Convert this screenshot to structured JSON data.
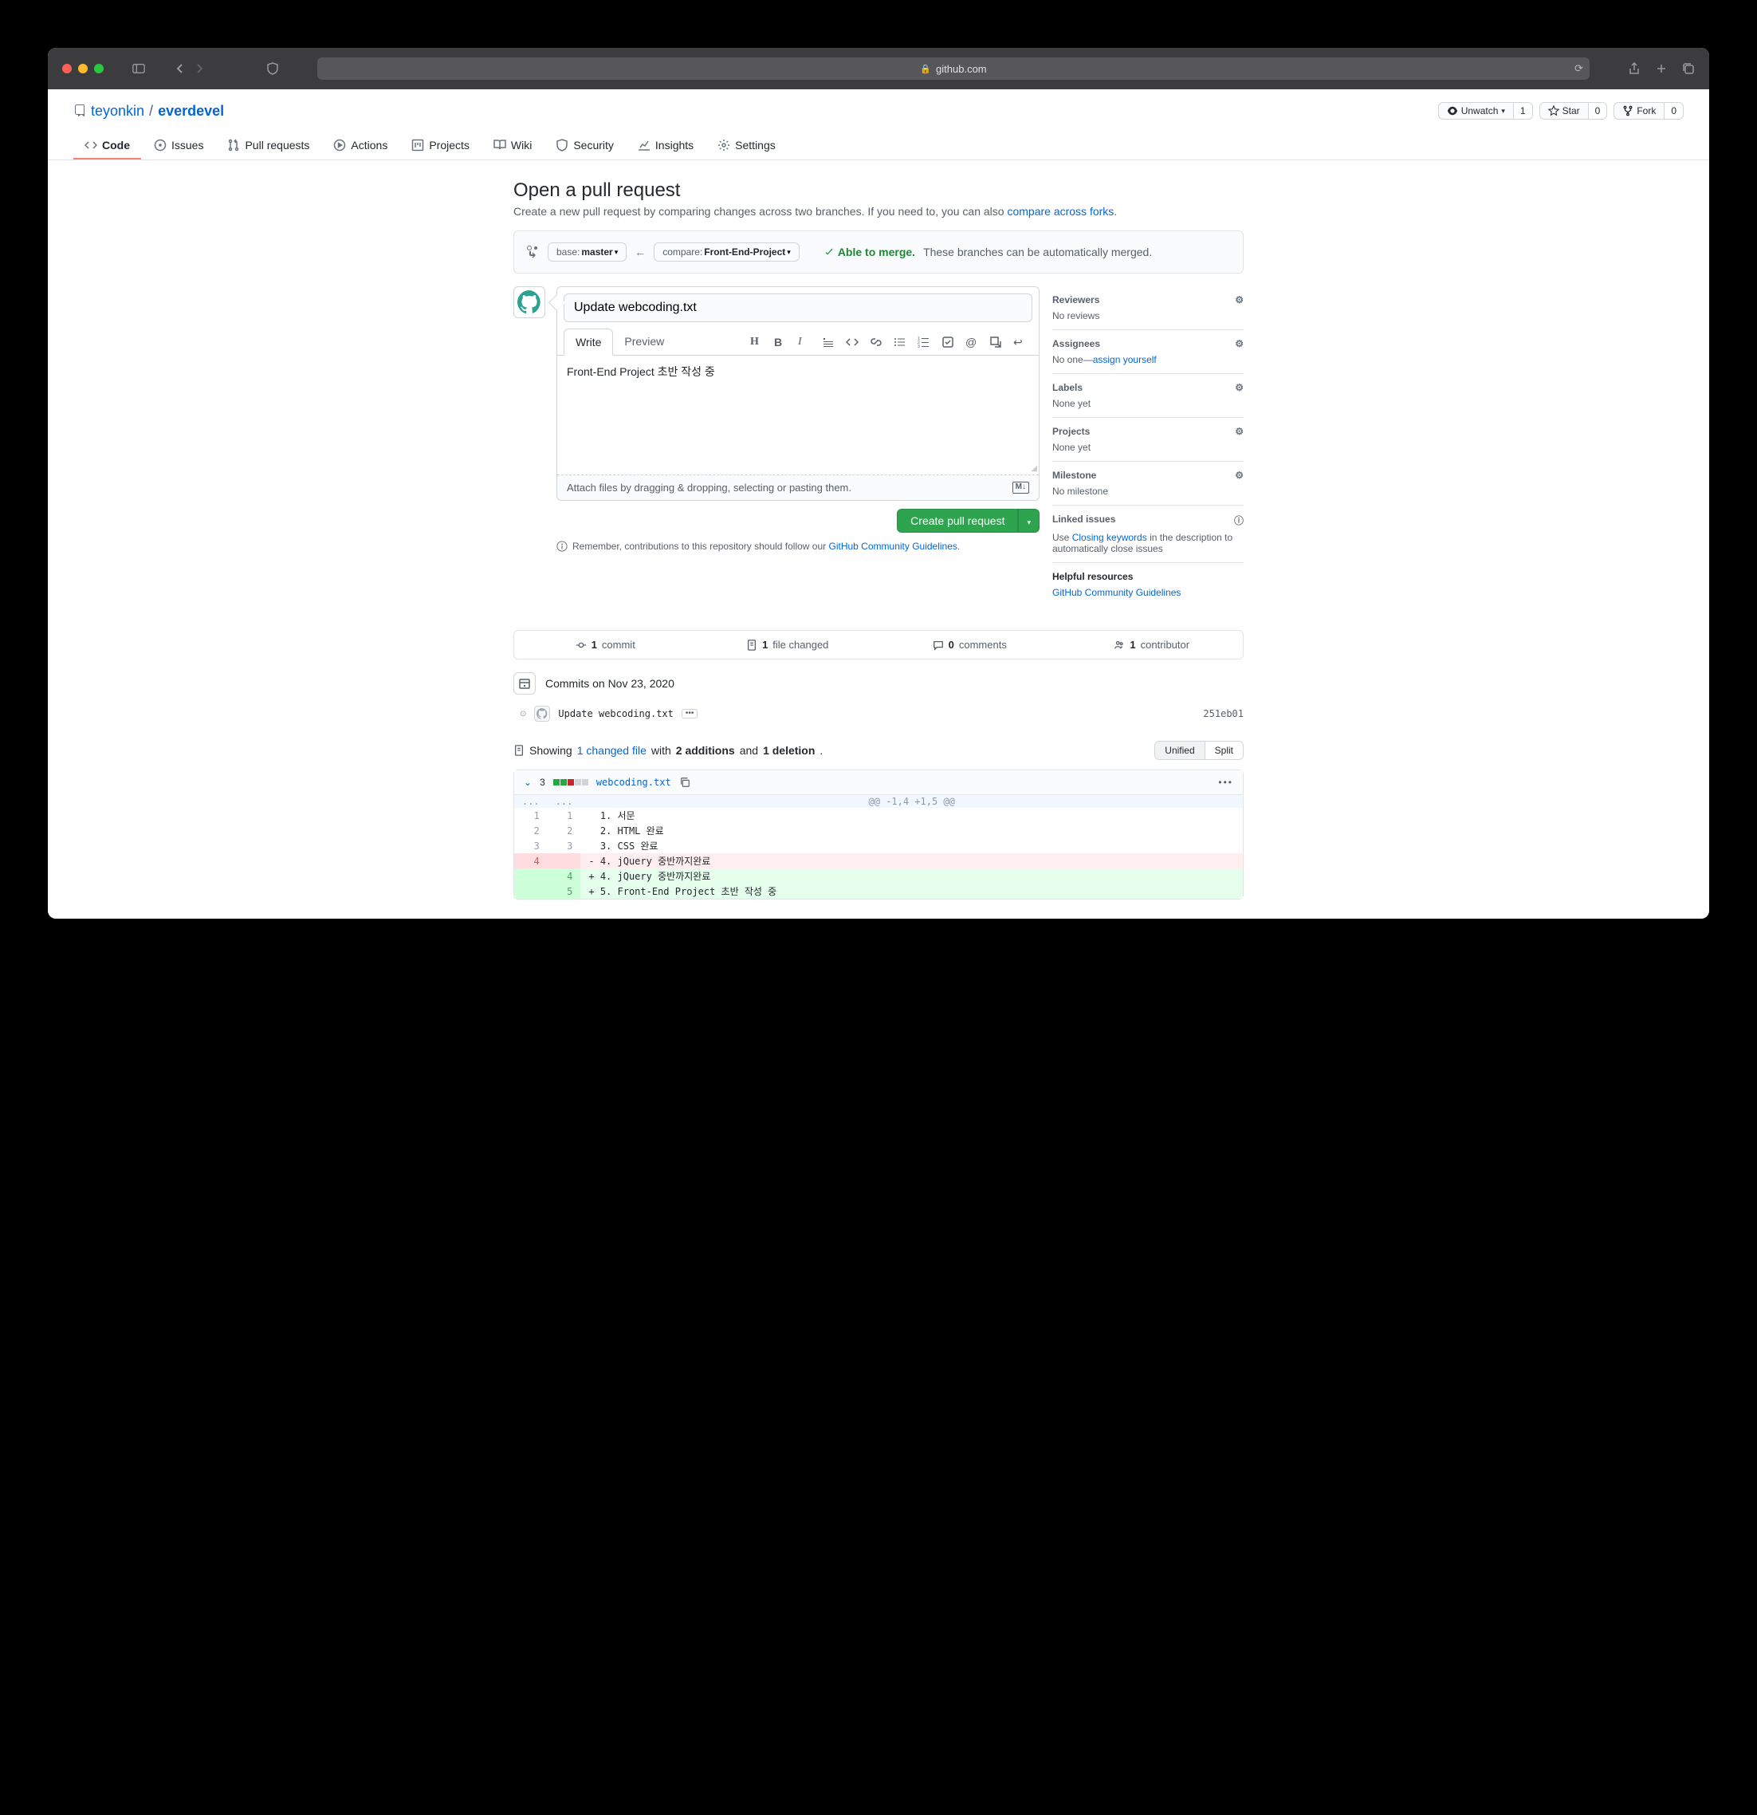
{
  "browser": {
    "url_host": "github.com"
  },
  "repo": {
    "owner": "teyonkin",
    "name": "everdevel"
  },
  "repo_actions": {
    "unwatch": "Unwatch",
    "unwatch_count": "1",
    "star": "Star",
    "star_count": "0",
    "fork": "Fork",
    "fork_count": "0"
  },
  "nav": {
    "code": "Code",
    "issues": "Issues",
    "pulls": "Pull requests",
    "actions": "Actions",
    "projects": "Projects",
    "wiki": "Wiki",
    "security": "Security",
    "insights": "Insights",
    "settings": "Settings"
  },
  "page": {
    "title": "Open a pull request",
    "subtitle_pre": "Create a new pull request by comparing changes across two branches. If you need to, you can also ",
    "subtitle_link": "compare across forks",
    "subtitle_post": "."
  },
  "compare": {
    "base_label": "base: ",
    "base_branch": "master",
    "compare_label": "compare: ",
    "compare_branch": "Front-End-Project",
    "able": "Able to merge.",
    "note": "These branches can be automatically merged."
  },
  "compose": {
    "title_value": "Update webcoding.txt",
    "tab_write": "Write",
    "tab_preview": "Preview",
    "body": "Front-End Project 초반 작성 중",
    "attach": "Attach files by dragging & dropping, selecting or pasting them.",
    "submit": "Create pull request"
  },
  "guideline": {
    "pre": "Remember, contributions to this repository should follow our ",
    "link": "GitHub Community Guidelines",
    "post": "."
  },
  "sidebar": {
    "reviewers": {
      "title": "Reviewers",
      "body": "No reviews"
    },
    "assignees": {
      "title": "Assignees",
      "body_pre": "No one—",
      "body_link": "assign yourself"
    },
    "labels": {
      "title": "Labels",
      "body": "None yet"
    },
    "projects": {
      "title": "Projects",
      "body": "None yet"
    },
    "milestone": {
      "title": "Milestone",
      "body": "No milestone"
    },
    "linked": {
      "title": "Linked issues",
      "body_pre": "Use ",
      "body_link": "Closing keywords",
      "body_post": " in the description to automatically close issues"
    },
    "resources": {
      "title": "Helpful resources",
      "link": "GitHub Community Guidelines"
    }
  },
  "summary": {
    "commits_n": "1",
    "commits_l": "commit",
    "files_n": "1",
    "files_l": "file changed",
    "comments_n": "0",
    "comments_l": "comments",
    "contribs_n": "1",
    "contribs_l": "contributor"
  },
  "timeline": {
    "date_label": "Commits on Nov 23, 2020",
    "commit_msg": "Update webcoding.txt",
    "commit_sha": "251eb01"
  },
  "changes": {
    "showing": "Showing ",
    "file_link": "1 changed file",
    "with": " with ",
    "additions": "2 additions",
    "and": " and ",
    "deletions": "1 deletion",
    "end": ".",
    "unified": "Unified",
    "split": "Split"
  },
  "diff": {
    "count": "3",
    "filename": "webcoding.txt",
    "hunk": "@@ -1,4 +1,5 @@",
    "lines": [
      {
        "type": "ctx",
        "ol": "1",
        "nl": "1",
        "text": "  1. 서문"
      },
      {
        "type": "ctx",
        "ol": "2",
        "nl": "2",
        "text": "  2. HTML 완료"
      },
      {
        "type": "ctx",
        "ol": "3",
        "nl": "3",
        "text": "  3. CSS 완료"
      },
      {
        "type": "del",
        "ol": "4",
        "nl": "",
        "text": "- 4. jQuery 중반까지완료"
      },
      {
        "type": "add",
        "ol": "",
        "nl": "4",
        "text": "+ 4. jQuery 중반까지완료"
      },
      {
        "type": "add",
        "ol": "",
        "nl": "5",
        "text": "+ 5. Front-End Project 초반 작성 중"
      }
    ]
  }
}
